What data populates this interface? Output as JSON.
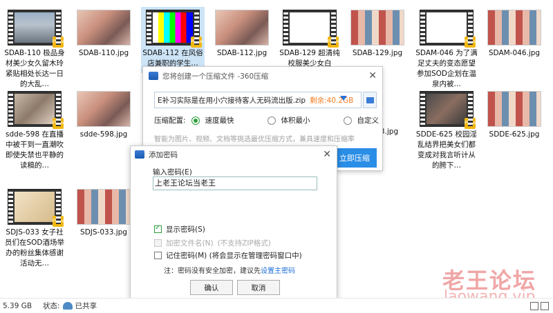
{
  "files": [
    {
      "label": "SDAB-110 极品身材美少女久留木玲紧贴相处长达一日的大乱…",
      "badge": "Player"
    },
    {
      "label": "SDAB-110.jpg"
    },
    {
      "label": "SDAB-112 在风俗店兼职的学生…",
      "badge": "Player"
    },
    {
      "label": "SDAB-112.jpg"
    },
    {
      "label": "SDAB-129 超清纯校服美少女白",
      "badge": "Player"
    },
    {
      "label": "SDAB-129.jpg"
    },
    {
      "label": "SDAM-046 为了满足丈夫的变态愿望参加SOD企划在温泉内被…",
      "badge": "Player"
    },
    {
      "label": "SDAM-046.jpg"
    },
    {
      "label": "sdde-598 在直播中被干到一直潮吹即使失禁也平静的读稿的…",
      "badge": "Player"
    },
    {
      "label": "sdde-598.jpg"
    },
    {
      "label": "3.jpg"
    },
    {
      "label": "SDDE-625 校园淫乱结界把美女们都变成对我言听计从的胯下…",
      "badge": "Player"
    },
    {
      "label": "SDDE-625.jpg"
    },
    {
      "label": "SDJS-033 女子社员们在SOD酒场举办的粉丝集体感谢活动无…",
      "badge": "Player"
    },
    {
      "label": "SDJS-033.jpg"
    }
  ],
  "compress_dialog": {
    "title": "您将创建一个压缩文件 -360压缩",
    "path": "E补习实际是在用小穴接待客人无码流出版.zip",
    "free_space": "剩余:40.2GB",
    "config_label": "压缩配置:",
    "options": [
      "速度最快",
      "体积最小",
      "自定义"
    ],
    "hint": "智能为图片、视频、文档等挑选最优压缩方式，兼具速度和压缩率",
    "compress_button": "立即压缩"
  },
  "password_dialog": {
    "title": "添加密码",
    "input_label": "输入密码(E)",
    "password_value": "上老王论坛当老王",
    "show_password": "显示密码(S)",
    "encrypt_names": "加密文件名(N)",
    "encrypt_names_note": "(不支持ZIP格式)",
    "remember_password": "记住密码(M) (将会显示在管理密码窗口中)",
    "note_prefix": "注：密码没有安全加密，建议先",
    "note_link": "设置主密码",
    "ok": "确认",
    "cancel": "取消"
  },
  "status": {
    "size": "5.39 GB",
    "state_label": "状态:",
    "state_value": "已共享"
  },
  "watermark": {
    "cn": "老王论坛",
    "en": "laowang.vip"
  }
}
